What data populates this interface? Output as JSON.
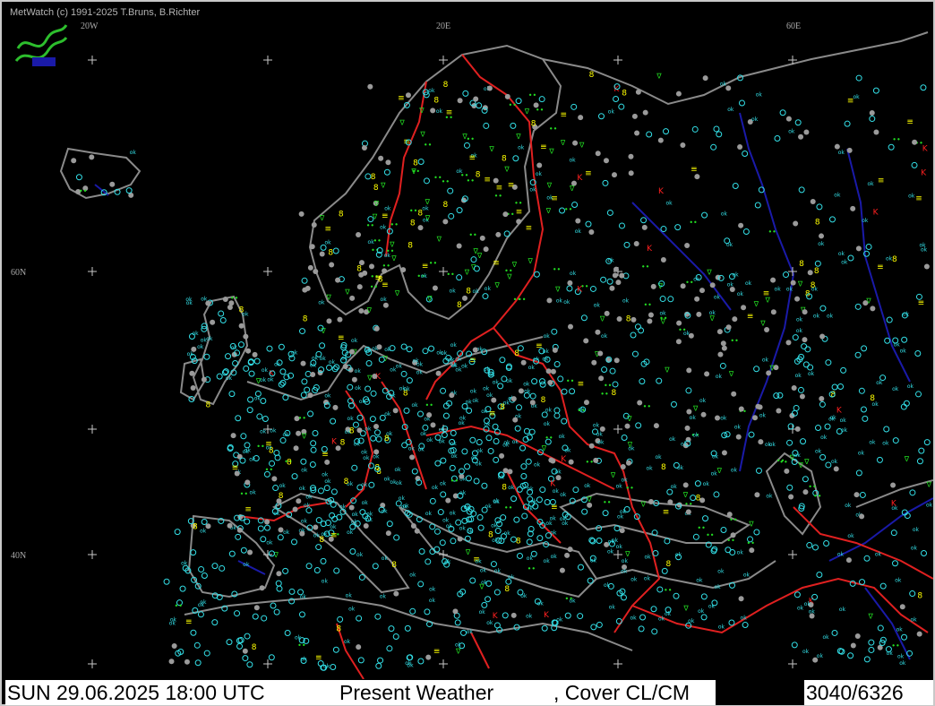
{
  "credit": "MetWatch  (c) 1991-2025 T.Bruns, B.Richter",
  "logo": {
    "name": "metwatch-logo",
    "color": "#2dbe2d"
  },
  "grid_labels": {
    "lon_20w": "20W",
    "lon_20e": "20E",
    "lon_60e": "60E",
    "lat_60n": "60N",
    "lat_40n": "40N"
  },
  "status": {
    "time": "SUN 29.06.2025 18:00 UTC",
    "parameter": "Present Weather",
    "cover": ", Cover CL/CM",
    "count": "3040/6326"
  },
  "colors": {
    "background": "#000000",
    "coastline": "#8a8a8a",
    "borders": "#e02020",
    "rivers": "#1a1aa8",
    "obs_ok": "#33e0e8",
    "obs_cloudy": "#9a9a9a",
    "obs_rain": "#22dd22",
    "obs_fog_haze": "#ffff00",
    "obs_thunder": "#ff2020"
  },
  "station_symbol_legend": [
    "ok",
    "clear",
    "partly-cloudy",
    "overcast",
    "rain",
    "showers",
    "haze",
    "fog",
    "thunderstorm"
  ]
}
